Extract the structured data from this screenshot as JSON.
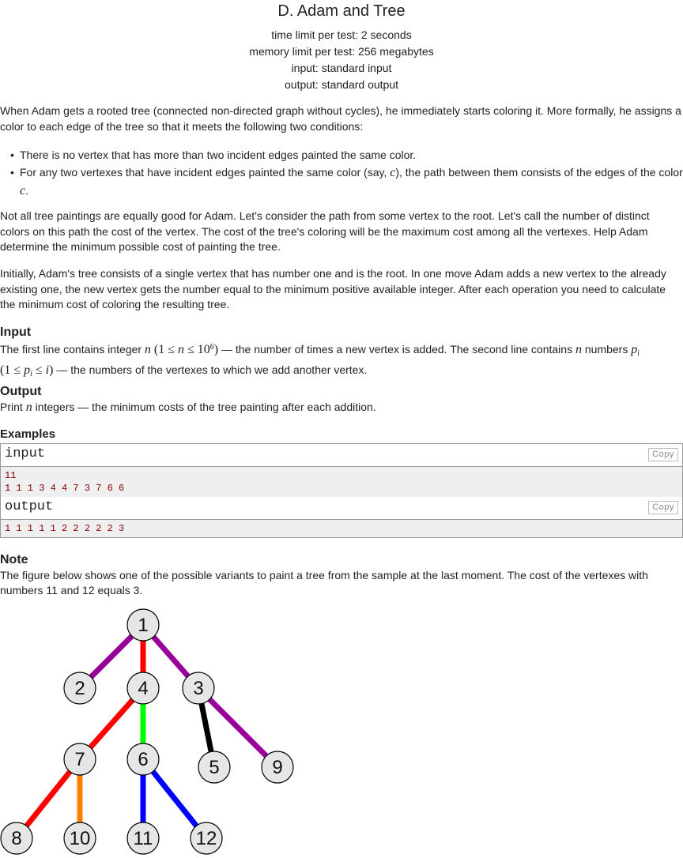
{
  "problem": {
    "title": "D. Adam and Tree",
    "time_limit": "time limit per test: 2 seconds",
    "memory_limit": "memory limit per test: 256 megabytes",
    "input_file": "input: standard input",
    "output_file": "output: standard output"
  },
  "statement": {
    "intro": "When Adam gets a rooted tree (connected non-directed graph without cycles), he immediately starts coloring it. More formally, he assigns a color to each edge of the tree so that it meets the following two conditions:",
    "cond1": "There is no vertex that has more than two incident edges painted the same color.",
    "cond2_a": "For any two vertexes that have incident edges painted the same color (say, ",
    "cond2_var": "c",
    "cond2_b": "), the path between them consists of the edges of the color ",
    "cond2_end_var": "c",
    "cond2_end": ".",
    "para2": "Not all tree paintings are equally good for Adam. Let's consider the path from some vertex to the root. Let's call the number of distinct colors on this path the cost of the vertex. The cost of the tree's coloring will be the maximum cost among all the vertexes. Help Adam determine the minimum possible cost of painting the tree.",
    "para3": "Initially, Adam's tree consists of a single vertex that has number one and is the root. In one move Adam adds a new vertex to the already existing one, the new vertex gets the number equal to the minimum positive available integer. After each operation you need to calculate the minimum cost of coloring the resulting tree."
  },
  "input_section": {
    "heading": "Input",
    "t1": "The first line contains integer ",
    "var_n": "n",
    "range_open": " (1 ≤ ",
    "range_n": "n",
    "range_le": " ≤ 10",
    "range_exp": "6",
    "range_close": ")",
    "t2": " — the number of times a new vertex is added. The second line contains ",
    "var_n2": "n",
    "t3": " numbers ",
    "var_p": "p",
    "var_p_sub": "i",
    "range2_open": "(1 ≤ ",
    "range2_p": "p",
    "range2_sub": "i",
    "range2_le": " ≤ ",
    "range2_i": "i",
    "range2_close": ")",
    "t4": " — the numbers of the vertexes to which we add another vertex."
  },
  "output_section": {
    "heading": "Output",
    "t1": "Print ",
    "var_n": "n",
    "t2": " integers — the minimum costs of the tree painting after each addition."
  },
  "examples": {
    "heading": "Examples",
    "input_label": "input",
    "output_label": "output",
    "copy_label": "Copy",
    "input_text": "11\n1 1 1 3 4 4 7 3 7 6 6",
    "output_text": "1 1 1 1 1 2 2 2 2 2 3"
  },
  "note": {
    "heading": "Note",
    "text": "The figure below shows one of the possible variants to paint a tree from the sample at the last moment. The cost of the vertexes with numbers 11 and 12 equals 3."
  },
  "tree_figure": {
    "nodes": [
      "1",
      "2",
      "4",
      "3",
      "7",
      "6",
      "5",
      "9",
      "8",
      "10",
      "11",
      "12"
    ],
    "edge_colors": {
      "purple": "#990099",
      "red": "#ff0000",
      "green": "#00ff00",
      "black": "#000000",
      "orange": "#ff8000",
      "blue": "#0000ff"
    },
    "node_fill": "#e6e6e6"
  }
}
